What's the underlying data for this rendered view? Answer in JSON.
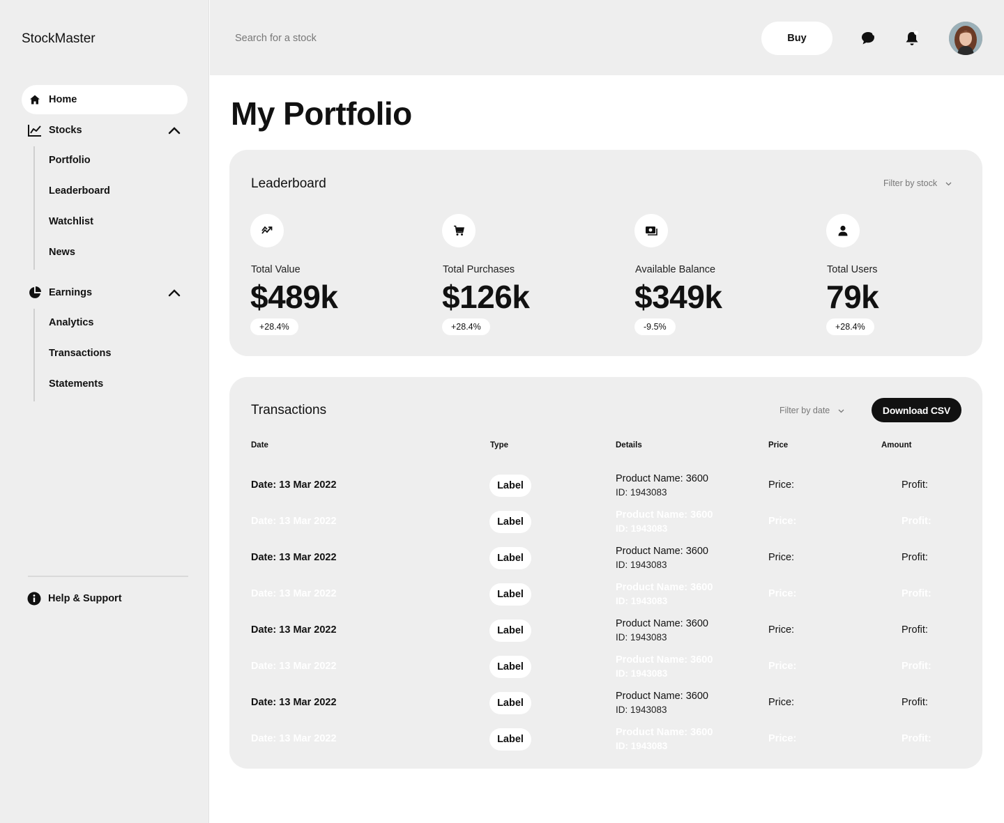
{
  "app": {
    "brand": "StockMaster"
  },
  "sidebar": {
    "home": "Home",
    "stocks": {
      "label": "Stocks",
      "items": [
        "Portfolio",
        "Leaderboard",
        "Watchlist",
        "News"
      ]
    },
    "earnings": {
      "label": "Earnings",
      "items": [
        "Analytics",
        "Transactions",
        "Statements"
      ]
    },
    "help": "Help & Support"
  },
  "topbar": {
    "search_placeholder": "Search for a stock",
    "buy_label": "Buy",
    "chat_icon": "chat-icon",
    "bell_icon": "bell-icon"
  },
  "page": {
    "title": "My Portfolio"
  },
  "leaderboard": {
    "title": "Leaderboard",
    "filter_label": "Filter by stock",
    "stats": [
      {
        "icon": "trend-icon",
        "label": "Total Value",
        "value": "$489k",
        "change": "+28.4%"
      },
      {
        "icon": "cart-icon",
        "label": "Total Purchases",
        "value": "$126k",
        "change": "+28.4%"
      },
      {
        "icon": "wallet-icon",
        "label": "Available Balance",
        "value": "$349k",
        "change": "-9.5%"
      },
      {
        "icon": "user-icon",
        "label": "Total Users",
        "value": "79k",
        "change": "+28.4%"
      }
    ]
  },
  "transactions": {
    "title": "Transactions",
    "filter_label": "Filter by date",
    "download_label": "Download CSV",
    "columns": [
      "Date",
      "Type",
      "Details",
      "Price",
      "Amount"
    ],
    "rows": [
      {
        "date": "Date: 13 Mar 2022",
        "type": "Label",
        "product": "Product Name: 3600",
        "id": "ID: 1943083",
        "price": "Price:",
        "amount": "Profit:"
      },
      {
        "date": "Date: 13 Mar 2022",
        "type": "Label",
        "product": "Product Name: 3600",
        "id": "ID: 1943083",
        "price": "Price:",
        "amount": "Profit:"
      },
      {
        "date": "Date: 13 Mar 2022",
        "type": "Label",
        "product": "Product Name: 3600",
        "id": "ID: 1943083",
        "price": "Price:",
        "amount": "Profit:"
      },
      {
        "date": "Date: 13 Mar 2022",
        "type": "Label",
        "product": "Product Name: 3600",
        "id": "ID: 1943083",
        "price": "Price:",
        "amount": "Profit:"
      },
      {
        "date": "Date: 13 Mar 2022",
        "type": "Label",
        "product": "Product Name: 3600",
        "id": "ID: 1943083",
        "price": "Price:",
        "amount": "Profit:"
      },
      {
        "date": "Date: 13 Mar 2022",
        "type": "Label",
        "product": "Product Name: 3600",
        "id": "ID: 1943083",
        "price": "Price:",
        "amount": "Profit:"
      },
      {
        "date": "Date: 13 Mar 2022",
        "type": "Label",
        "product": "Product Name: 3600",
        "id": "ID: 1943083",
        "price": "Price:",
        "amount": "Profit:"
      },
      {
        "date": "Date: 13 Mar 2022",
        "type": "Label",
        "product": "Product Name: 3600",
        "id": "ID: 1943083",
        "price": "Price:",
        "amount": "Profit:"
      }
    ]
  }
}
